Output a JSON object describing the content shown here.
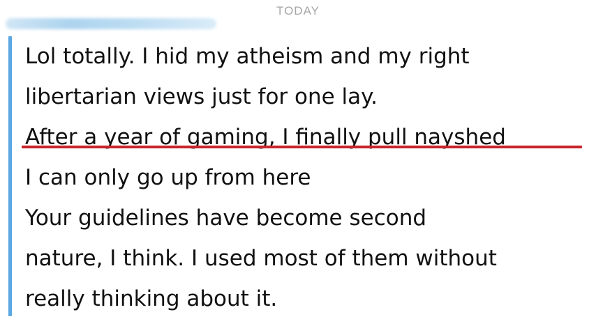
{
  "chat": {
    "date_header": "TODAY",
    "messages": [
      "Lol totally. I hid my atheism and my right",
      "libertarian views just for one lay.",
      "After a year of gaming, I finally pull nayshed",
      "I can only go up from here",
      "Your guidelines have become second",
      "nature, I think. I used most of them without",
      "really thinking about it."
    ]
  },
  "colors": {
    "message_bar": "#5aa8e4",
    "underline": "#c8242c",
    "date_header": "#a6a6a6",
    "text": "#111111"
  }
}
